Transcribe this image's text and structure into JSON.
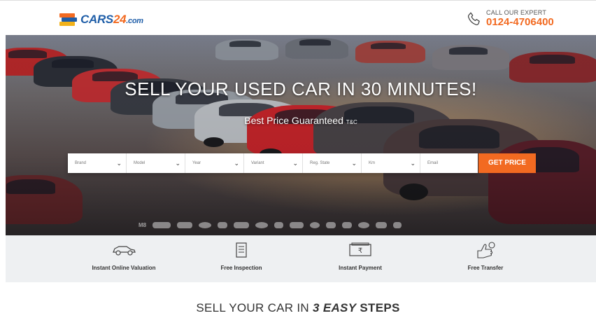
{
  "header": {
    "logo": {
      "main": "CARS",
      "num": "24",
      "suffix": ".com"
    },
    "call": {
      "label": "CALL OUR EXPERT",
      "number": "0124-4706400",
      "icon": "phone-icon"
    }
  },
  "hero": {
    "title": "SELL YOUR USED CAR IN 30 MINUTES!",
    "subtitle": "Best Price Guaranteed",
    "subtitle_note": "T&C",
    "form": {
      "brand": "Brand",
      "model": "Model",
      "year": "Year",
      "variant": "Variant",
      "reg_state": "Reg. State",
      "km": "Km",
      "email": "Email",
      "submit": "GET PRICE"
    },
    "brand_logos": [
      "M8",
      "audi",
      "chevrolet",
      "ford",
      "honda",
      "hyundai",
      "hyundai-h",
      "jeep",
      "kia",
      "mahindra",
      "nissan",
      "renault",
      "skoda",
      "toyota",
      "vw"
    ]
  },
  "features": [
    {
      "icon": "car-icon",
      "label": "Instant Online Valuation"
    },
    {
      "icon": "document-icon",
      "label": "Free Inspection"
    },
    {
      "icon": "payment-icon",
      "label": "Instant Payment"
    },
    {
      "icon": "transfer-icon",
      "label": "Free Transfer"
    }
  ],
  "steps": {
    "pre": "SELL YOUR CAR IN",
    "num": "3",
    "easy": "EASY",
    "post": "STEPS"
  },
  "colors": {
    "accent": "#f26a21",
    "brand_blue": "#1f5ea8",
    "strip_bg": "#eef0f2"
  }
}
